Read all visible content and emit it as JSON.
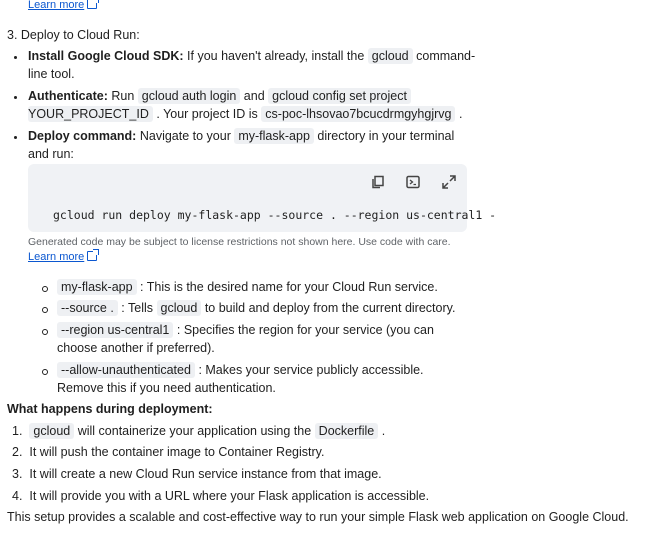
{
  "top_link": "Learn more",
  "step3_heading": "3. Deploy to Cloud Run:",
  "bullets": {
    "sdk": {
      "label": "Install Google Cloud SDK:",
      "pre": "If you haven't already, install the",
      "code": "gcloud",
      "post": "command-",
      "line2": "line tool."
    },
    "auth": {
      "label": "Authenticate:",
      "pre": "Run",
      "code1": "gcloud auth login",
      "mid": "and",
      "code2a": "gcloud config set project",
      "code2b": "YOUR_PROJECT_ID",
      "post": ". Your project ID is",
      "project_id": "cs-poc-lhsovao7bcucdrmgyhgjrvg",
      "end": "."
    },
    "deploy": {
      "label": "Deploy command:",
      "pre": "Navigate to your",
      "code": "my-flask-app",
      "post": "directory in your terminal",
      "line2": "and run:"
    }
  },
  "codeblock": {
    "command": "gcloud run deploy my-flask-app --source . --region us-central1 -",
    "copy_icon": "copy-icon",
    "terminal_icon": "terminal-icon",
    "expand_icon": "expand-icon"
  },
  "disclaimer": "Generated code may be subject to license restrictions not shown here. Use code with care.",
  "disclaimer_link": "Learn more",
  "sub_items": [
    {
      "code": "my-flask-app",
      "text": ": This is the desired name for your Cloud Run service."
    },
    {
      "code": "--source .",
      "text": ": Tells",
      "code2": "gcloud",
      "text2": "to build and deploy from the current directory."
    },
    {
      "code": "--region us-central1",
      "text": ": Specifies the region for your service (you can",
      "line2": "choose another if preferred)."
    },
    {
      "code": "--allow-unauthenticated",
      "text": ": Makes your service publicly accessible.",
      "line2": "Remove this if you need authentication."
    }
  ],
  "deployment_heading": "What happens during deployment:",
  "steps": [
    {
      "num": "1.",
      "code": "gcloud",
      "text": "will containerize your application using the",
      "code2": "Dockerfile",
      "end": "."
    },
    {
      "num": "2.",
      "text": "It will push the container image to Container Registry."
    },
    {
      "num": "3.",
      "text": "It will create a new Cloud Run service instance from that image."
    },
    {
      "num": "4.",
      "text": "It will provide you with a URL where your Flask application is accessible."
    }
  ],
  "closing": "This setup provides a scalable and cost-effective way to run your simple Flask web application on Google Cloud."
}
